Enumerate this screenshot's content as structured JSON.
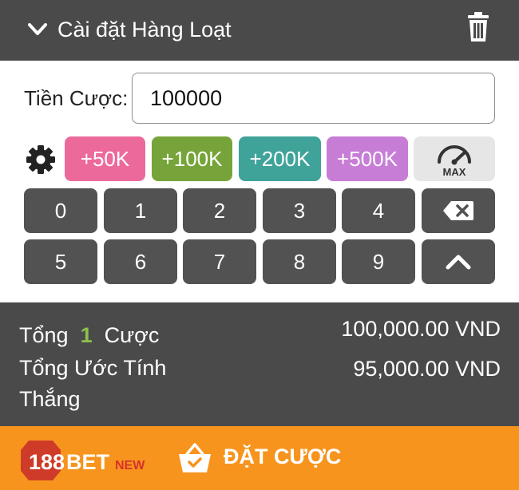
{
  "header": {
    "title": "Cài đặt Hàng Loạt"
  },
  "stake": {
    "label": "Tiền Cược:",
    "value": "100000"
  },
  "quick_buttons": [
    {
      "label": "+50K",
      "color": "#ec6a9b"
    },
    {
      "label": "+100K",
      "color": "#77a43a"
    },
    {
      "label": "+200K",
      "color": "#3fa39a"
    },
    {
      "label": "+500K",
      "color": "#c77dd6"
    }
  ],
  "max_button": {
    "label": "MAX"
  },
  "keypad": {
    "row1": [
      "0",
      "1",
      "2",
      "3",
      "4"
    ],
    "row2": [
      "5",
      "6",
      "7",
      "8",
      "9"
    ]
  },
  "summary": {
    "total_prefix": "Tổng",
    "total_count": "1",
    "total_suffix": "Cược",
    "total_amount": "100,000.00 VND",
    "est_label_line1": "Tổng Ước Tính",
    "est_label_line2": "Thắng",
    "est_amount": "95,000.00 VND"
  },
  "footer": {
    "logo_number": "188",
    "logo_word": "BET",
    "logo_tag": "NEW",
    "place_bet_label": "ĐẶT CƯỢC"
  },
  "colors": {
    "header_bg": "#4a4a4a",
    "key_bg": "#525252",
    "footer_bg": "#f7941d",
    "count_green": "#8cc04f"
  }
}
